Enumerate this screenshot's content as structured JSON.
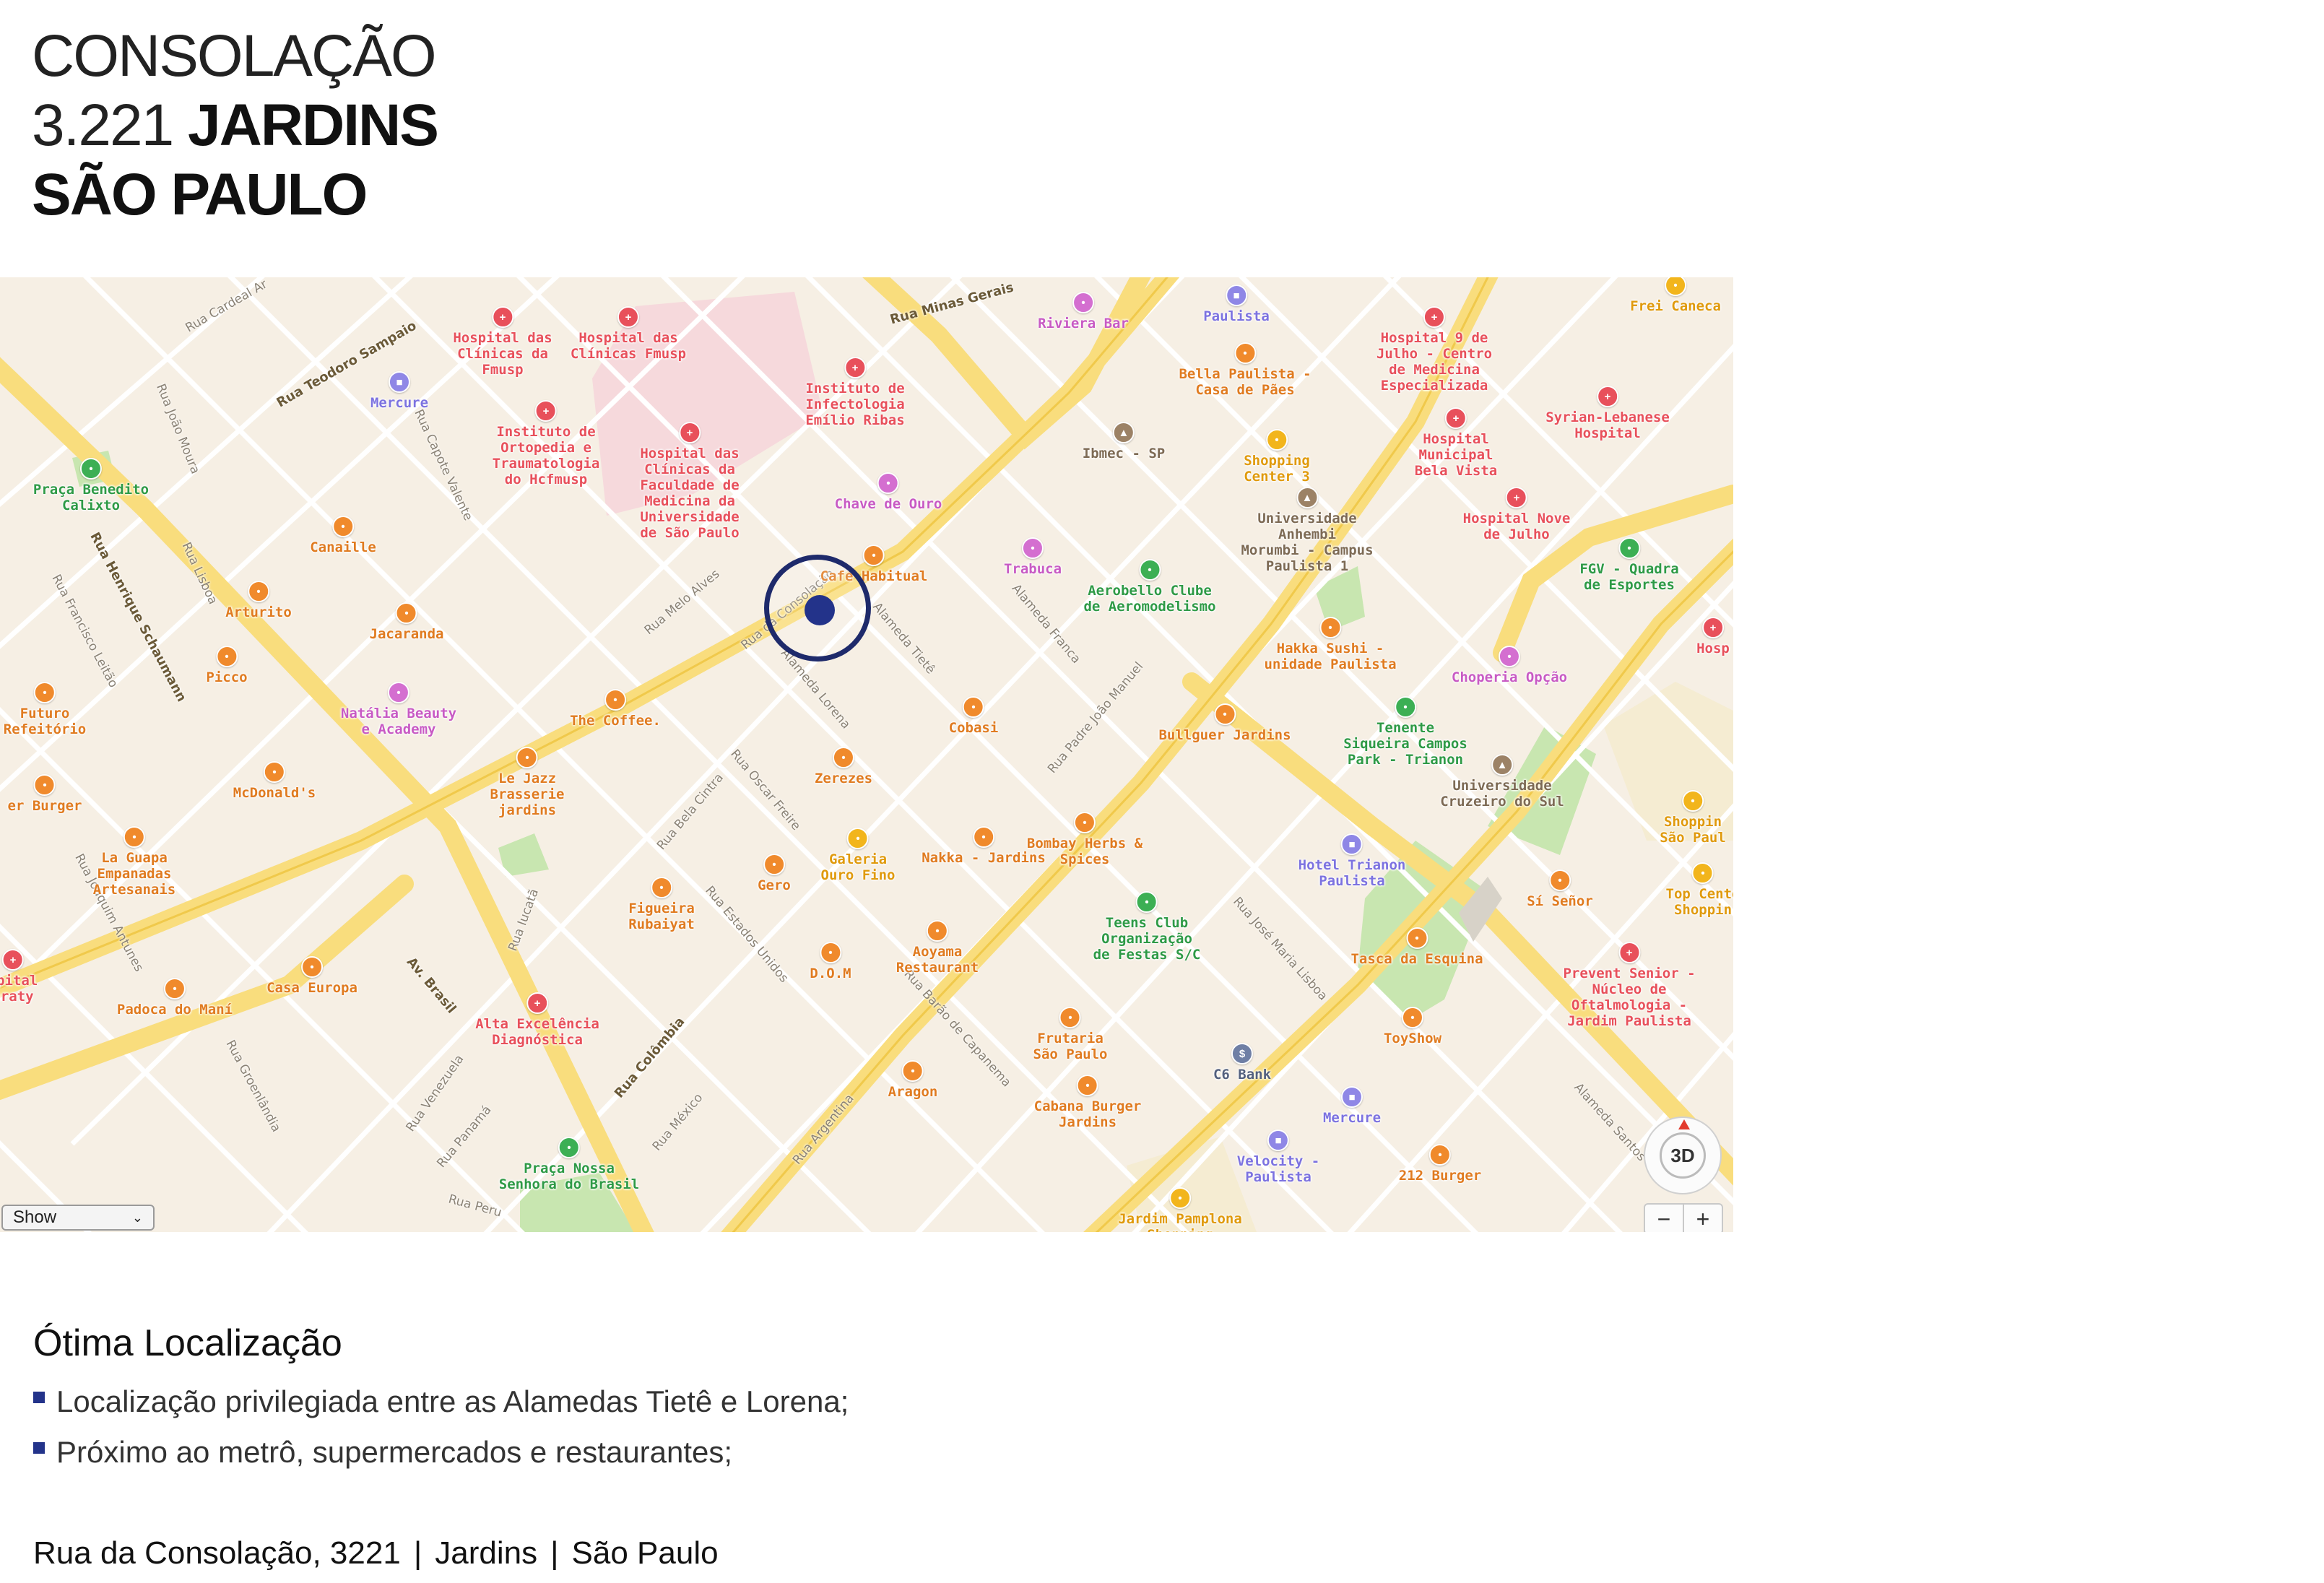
{
  "header": {
    "line1": "CONSOLAÇÃO",
    "line2_number": "3.221",
    "line2_area": "JARDINS",
    "line3": "SÃO PAULO"
  },
  "map": {
    "select_value": "Show",
    "compass_label": "3D",
    "zoom_out": "−",
    "zoom_in": "+",
    "colors": {
      "marker": "#23338a",
      "hospital": "#e8505b",
      "food": "#f08a2c",
      "park": "#c8e6b0",
      "major_road": "#f9dd7d"
    },
    "pois": [
      {
        "label": "Hospital das\nClínicas da\nFmusp",
        "cat": "hospital"
      },
      {
        "label": "Hospital das\nClínicas Fmusp",
        "cat": "hospital"
      },
      {
        "label": "Instituto de\nInfectologia\nEmílio Ribas",
        "cat": "hospital"
      },
      {
        "label": "Instituto de\nOrtopedia e\nTraumatologia\ndo Hcfmusp",
        "cat": "hospital"
      },
      {
        "label": "Hospital das\nClínicas da\nFaculdade de\nMedicina da\nUniversidade\nde São Paulo",
        "cat": "hospital"
      },
      {
        "label": "Mercure",
        "cat": "hotel"
      },
      {
        "label": "Praça Benedito\nCalixto",
        "cat": "park"
      },
      {
        "label": "Canaille",
        "cat": "food"
      },
      {
        "label": "Arturito",
        "cat": "food"
      },
      {
        "label": "Jacaranda",
        "cat": "food"
      },
      {
        "label": "Picco",
        "cat": "food"
      },
      {
        "label": "Futuro\nRefeitório",
        "cat": "food"
      },
      {
        "label": "Natália Beauty\ne Academy",
        "cat": "shop"
      },
      {
        "label": "McDonald's",
        "cat": "food"
      },
      {
        "label": "Le Jazz\nBrasserie\njardins",
        "cat": "food"
      },
      {
        "label": "The Coffee.",
        "cat": "food"
      },
      {
        "label": "Chave de Ouro",
        "cat": "shop"
      },
      {
        "label": "Café Habitual",
        "cat": "food"
      },
      {
        "label": "Riviera Bar",
        "cat": "shop"
      },
      {
        "label": "Paulista",
        "cat": "hotel"
      },
      {
        "label": "Bella Paulista -\nCasa de Pães",
        "cat": "food"
      },
      {
        "label": "Ibmec - SP",
        "cat": "edu"
      },
      {
        "label": "Shopping\nCenter 3",
        "cat": "mall"
      },
      {
        "label": "Trabuca",
        "cat": "shop"
      },
      {
        "label": "Aerobello Clube\nde Aeromodelismo",
        "cat": "park"
      },
      {
        "label": "Universidade\nAnhembi\nMorumbi - Campus\nPaulista 1",
        "cat": "edu"
      },
      {
        "label": "Hakka Sushi -\nunidade Paulista",
        "cat": "food"
      },
      {
        "label": "Hospital 9 de\nJulho - Centro\nde Medicina\nEspecializada",
        "cat": "hospital"
      },
      {
        "label": "Syrian-Lebanese\nHospital",
        "cat": "hospital"
      },
      {
        "label": "Hospital\nMunicipal\nBela Vista",
        "cat": "hospital"
      },
      {
        "label": "Hospital Nove\nde Julho",
        "cat": "hospital"
      },
      {
        "label": "FGV - Quadra\nde Esportes",
        "cat": "park"
      },
      {
        "label": "Choperia Opção",
        "cat": "shop"
      },
      {
        "label": "Tenente\nSiqueira Campos\nPark - Trianon",
        "cat": "park"
      },
      {
        "label": "Bullguer Jardins",
        "cat": "food"
      },
      {
        "label": "Cobasi",
        "cat": "food"
      },
      {
        "label": "Zerezes",
        "cat": "food"
      },
      {
        "label": "Bombay Herbs &\nSpices",
        "cat": "food"
      },
      {
        "label": "Universidade\nCruzeiro do Sul",
        "cat": "edu"
      },
      {
        "label": "Shoppin\nSão Paul",
        "cat": "mall"
      },
      {
        "label": "La Guapa\nEmpanadas\nArtesanais",
        "cat": "food"
      },
      {
        "label": "er Burger",
        "cat": "food"
      },
      {
        "label": "Figueira\nRubaiyat",
        "cat": "food"
      },
      {
        "label": "Gero",
        "cat": "food"
      },
      {
        "label": "Galeria\nOuro Fino",
        "cat": "mall"
      },
      {
        "label": "Nakka - Jardins",
        "cat": "food"
      },
      {
        "label": "Hotel Trianon\nPaulista",
        "cat": "hotel"
      },
      {
        "label": "Sí Señor",
        "cat": "food"
      },
      {
        "label": "Top Cente\nShoppin",
        "cat": "mall"
      },
      {
        "label": "Teens Club\nOrganização\nde Festas S/C",
        "cat": "park"
      },
      {
        "label": "Aoyama\nRestaurant",
        "cat": "food"
      },
      {
        "label": "D.O.M",
        "cat": "food"
      },
      {
        "label": "Tasca da Esquina",
        "cat": "food"
      },
      {
        "label": "Prevent Senior -\nNúcleo de\nOftalmologia -\nJardim Paulista",
        "cat": "hospital"
      },
      {
        "label": "Casa Europa",
        "cat": "food"
      },
      {
        "label": "Padoca do Maní",
        "cat": "food"
      },
      {
        "label": "spital\naraty",
        "cat": "hospital"
      },
      {
        "label": "Alta Excelência\nDiagnóstica",
        "cat": "hospital"
      },
      {
        "label": "Frutaria\nSão Paulo",
        "cat": "food"
      },
      {
        "label": "ToyShow",
        "cat": "food"
      },
      {
        "label": "C6 Bank",
        "cat": "bank"
      },
      {
        "label": "Aragon",
        "cat": "food"
      },
      {
        "label": "Cabana Burger\nJardins",
        "cat": "food"
      },
      {
        "label": "Mercure",
        "cat": "hotel"
      },
      {
        "label": "Praça Nossa\nSenhora do Brasil",
        "cat": "park"
      },
      {
        "label": "Velocity -\nPaulista",
        "cat": "hotel"
      },
      {
        "label": "212 Burger",
        "cat": "food"
      },
      {
        "label": "Jardim Pamplona\nShopping",
        "cat": "mall"
      },
      {
        "label": "Hosp",
        "cat": "hospital"
      },
      {
        "label": "Frei Caneca",
        "cat": "mall"
      }
    ],
    "streets": [
      "Rua Cardeal Ar",
      "Rua Teodoro Sampaio",
      "Rua Minas Gerais",
      "Rua João Moura",
      "Rua Capote Valente",
      "Rua Lisboa",
      "Rua Henrique Schaumann",
      "Rua Francisco Leitão",
      "Rua Melo Alves",
      "Rua da Consolação",
      "Alameda Tietê",
      "Alameda Lorena",
      "Alameda Franca",
      "Rua Padre João Manuel",
      "Rua Oscar Freire",
      "Rua Bela Cintra",
      "Rua Iucatã",
      "Rua Estados Unidos",
      "Rua Joaquim Antunes",
      "Av. Brasil",
      "Rua Groenlândia",
      "Rua Venezuela",
      "Rua Panamá",
      "Rua Colômbia",
      "Rua México",
      "Rua Argentina",
      "Rua Barão de Capanema",
      "Rua José Maria Lisboa",
      "Alameda Santos",
      "Rua Peru"
    ]
  },
  "section": {
    "title": "Ótima Localização",
    "bullets": [
      "Localização privilegiada entre as Alamedas Tietê e Lorena;",
      "Próximo ao metrô, supermercados e restaurantes;"
    ]
  },
  "address": {
    "street": "Rua da Consolação, 3221",
    "separator": "|",
    "district": "Jardins",
    "city": "São Paulo"
  }
}
